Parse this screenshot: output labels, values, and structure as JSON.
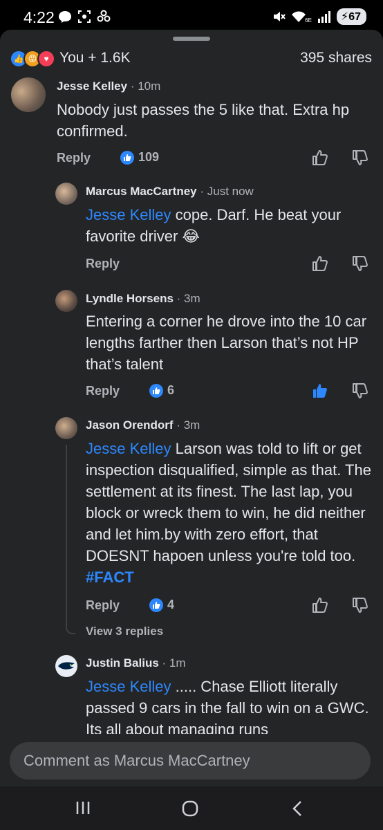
{
  "status": {
    "time": "4:22",
    "battery": "67",
    "network": "6E"
  },
  "summary": {
    "reactions_label": "You + 1.6K",
    "shares_label": "395 shares"
  },
  "comments": [
    {
      "author": "Jesse Kelley",
      "time": "· 10m",
      "text": "Nobody just passes the 5 like that. Extra hp confirmed.",
      "reply": "Reply",
      "likes": "109"
    },
    {
      "author": "Marcus MacCartney",
      "time": "· Just now",
      "mention": "Jesse Kelley",
      "text": " cope. Darf. He beat your favorite driver ",
      "emoji": "😂",
      "reply": "Reply"
    },
    {
      "author": "Lyndle Horsens",
      "time": "· 3m",
      "text": "Entering a corner he drove into the 10 car lengths farther then Larson that’s not HP that’s talent",
      "reply": "Reply",
      "likes": "6"
    },
    {
      "author": "Jason Orendorf",
      "time": "· 3m",
      "mention": "Jesse Kelley",
      "text": " Larson was told to lift or get inspection disqualified, simple as that. The settlement at its finest. The last lap, you block or wreck them to win, he did neither and let him.by with zero effort, that DOESNT hapoen unless you're told too. ",
      "hashtag": "#FACT",
      "reply": "Reply",
      "likes": "4",
      "view_replies": "View 3 replies"
    },
    {
      "author": "Justin Balius",
      "time": "· 1m",
      "mention": "Jesse Kelley",
      "text": " ..... Chase Elliott literally passed 9 cars in the fall to win on a GWC. Its all about managing runs"
    }
  ],
  "composer": {
    "placeholder": "Comment as Marcus MacCartney"
  },
  "colors": {
    "accent": "#2d88ff",
    "background": "#242526",
    "input": "#3a3b3c"
  }
}
